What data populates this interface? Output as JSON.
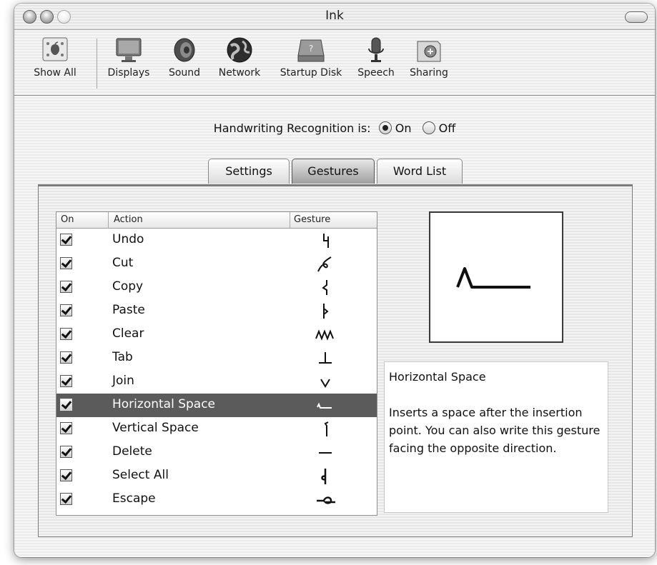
{
  "window": {
    "title": "Ink"
  },
  "toolbar": {
    "items": [
      {
        "label": "Show All",
        "icon": "show-all-icon"
      },
      {
        "label": "Displays",
        "icon": "displays-icon"
      },
      {
        "label": "Sound",
        "icon": "sound-icon"
      },
      {
        "label": "Network",
        "icon": "network-icon"
      },
      {
        "label": "Startup Disk",
        "icon": "startup-disk-icon"
      },
      {
        "label": "Speech",
        "icon": "speech-icon"
      },
      {
        "label": "Sharing",
        "icon": "sharing-icon"
      }
    ]
  },
  "recognition": {
    "label": "Handwriting Recognition is:",
    "options": [
      "On",
      "Off"
    ],
    "selected": "On"
  },
  "tabs": [
    {
      "label": "Settings"
    },
    {
      "label": "Gestures"
    },
    {
      "label": "Word List"
    }
  ],
  "active_tab": "Gestures",
  "table": {
    "columns": [
      "On",
      "Action",
      "Gesture"
    ],
    "rows": [
      {
        "on": true,
        "action": "Undo"
      },
      {
        "on": true,
        "action": "Cut"
      },
      {
        "on": true,
        "action": "Copy"
      },
      {
        "on": true,
        "action": "Paste"
      },
      {
        "on": true,
        "action": "Clear"
      },
      {
        "on": true,
        "action": "Tab"
      },
      {
        "on": true,
        "action": "Join"
      },
      {
        "on": true,
        "action": "Horizontal Space"
      },
      {
        "on": true,
        "action": "Vertical Space"
      },
      {
        "on": true,
        "action": "Delete"
      },
      {
        "on": true,
        "action": "Select All"
      },
      {
        "on": true,
        "action": "Escape"
      }
    ],
    "selected_row": "Horizontal Space"
  },
  "description": {
    "title": "Horizontal Space",
    "body": "Inserts a space after the insertion point. You can also write this gesture facing the opposite direction."
  },
  "colors": {
    "selection": "#5b5b5b",
    "active_tab": "#9f9f9f"
  }
}
